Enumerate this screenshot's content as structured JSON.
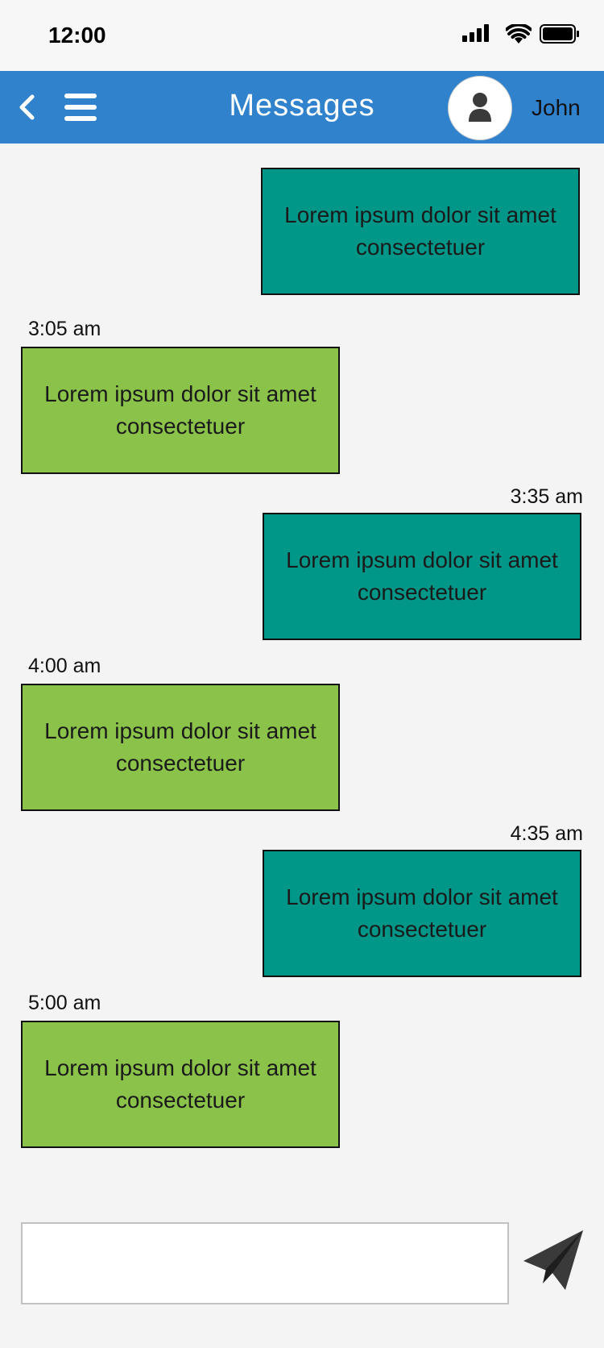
{
  "status_bar": {
    "time": "12:00",
    "icons": [
      "signal-icon",
      "wifi-icon",
      "battery-icon"
    ]
  },
  "header": {
    "title": "Messages",
    "user_name": "John",
    "back_icon": "chevron-left-icon",
    "menu_icon": "hamburger-menu-icon",
    "avatar_icon": "user-icon",
    "background_color": "#3182cc"
  },
  "messages": [
    {
      "direction": "sent",
      "time": "",
      "text": "Lorem ipsum dolor sit amet consectetuer"
    },
    {
      "direction": "received",
      "time": "3:05 am",
      "text": "Lorem ipsum dolor sit amet consectetuer"
    },
    {
      "direction": "sent",
      "time": "3:35 am",
      "text": "Lorem ipsum dolor sit amet consectetuer"
    },
    {
      "direction": "received",
      "time": "4:00 am",
      "text": "Lorem ipsum dolor sit amet consectetuer"
    },
    {
      "direction": "sent",
      "time": "4:35 am",
      "text": "Lorem ipsum dolor sit amet consectetuer"
    },
    {
      "direction": "received",
      "time": "5:00 am",
      "text": "Lorem ipsum dolor sit amet consectetuer"
    }
  ],
  "colors": {
    "sent_bubble": "#009688",
    "received_bubble": "#8bc34a"
  },
  "composer": {
    "value": "",
    "placeholder": "",
    "send_icon": "paper-plane-icon"
  }
}
